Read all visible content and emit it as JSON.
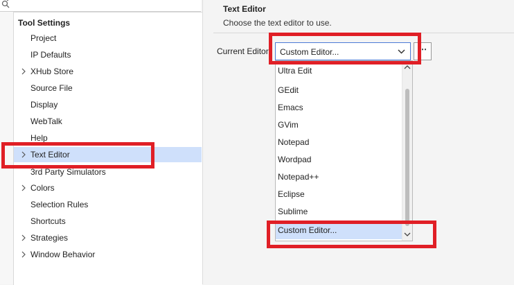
{
  "tree": {
    "title": "Tool Settings",
    "items": [
      {
        "label": "Project"
      },
      {
        "label": "IP Defaults"
      },
      {
        "label": "XHub Store"
      },
      {
        "label": "Source File"
      },
      {
        "label": "Display"
      },
      {
        "label": "WebTalk"
      },
      {
        "label": "Help"
      },
      {
        "label": "Text Editor"
      },
      {
        "label": "3rd Party Simulators"
      },
      {
        "label": "Colors"
      },
      {
        "label": "Selection Rules"
      },
      {
        "label": "Shortcuts"
      },
      {
        "label": "Strategies"
      },
      {
        "label": "Window Behavior"
      }
    ]
  },
  "editor_section": {
    "title": "Text Editor",
    "description": "Choose the text editor to use.",
    "field_label": "Current Editor:",
    "current_value": "Custom Editor...",
    "browse_label": "⋯"
  },
  "dropdown": {
    "options": [
      "Ultra Edit",
      "GEdit",
      "Emacs",
      "GVim",
      "Notepad",
      "Wordpad",
      "Notepad++",
      "Eclipse",
      "Sublime",
      "Custom Editor..."
    ],
    "selected": "Custom Editor..."
  },
  "colors": {
    "highlight": "#e01f26",
    "selection": "#cfe0fb",
    "focus_border": "#4a7ad6"
  }
}
